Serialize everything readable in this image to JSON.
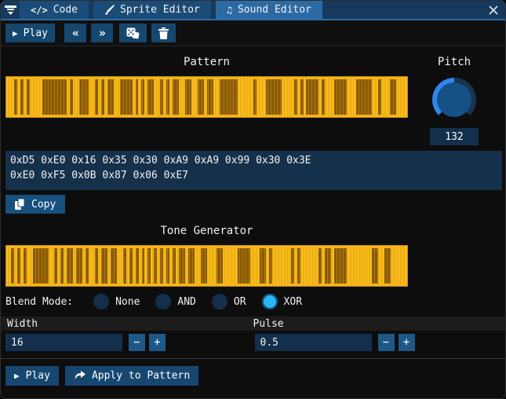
{
  "window": {
    "close_icon": "close"
  },
  "tabs": [
    {
      "label": "Code",
      "icon_text": "</>",
      "active": false
    },
    {
      "label": "Sprite Editor",
      "icon": "brush",
      "active": false
    },
    {
      "label": "Sound Editor",
      "icon_text": "♫",
      "active": true
    }
  ],
  "toolbar": {
    "play_label": "Play",
    "play_icon": "▶",
    "prev_icon": "«",
    "next_icon": "»",
    "random_icon": "dice",
    "delete_icon": "trash"
  },
  "pattern": {
    "title": "Pattern",
    "hex_text": "0xD5 0xE0 0x16 0x35 0x30 0xA9 0xA9 0x99 0x30 0x3E\n0xE0 0xF5 0x0B 0x87 0x06 0xE7",
    "copy_label": "Copy"
  },
  "pitch": {
    "title": "Pitch",
    "value": "132"
  },
  "tone": {
    "title": "Tone Generator",
    "segments": "y1 b1 y1 b1 y1 b1 y2 b5 y2 b1 y1 b1 y1 b2 y1 b2 y1 b1 y2 b1 y1 b2 y1 b2 y2 b1 y1 b1 y1 b1 y1 b1 y1 b1 y1 b1 y1 b1 y1 b1 y1 b1 y1 b2 y1 b2 y2 b2 y3 b2 y5 b4 y3 b2 y1 b1 y6 b1 y1 b1 y6 b1 y1 b2 y1 b4 y8 b2 y2 b2 y5"
  },
  "blend": {
    "label": "Blend Mode:",
    "options": [
      "None",
      "AND",
      "OR",
      "XOR"
    ],
    "selected": "XOR",
    "selected_index": 3
  },
  "width_field": {
    "label": "Width",
    "value": "16",
    "minus": "−",
    "plus": "+"
  },
  "pulse_field": {
    "label": "Pulse",
    "value": "0.5",
    "minus": "−",
    "plus": "+"
  },
  "footer": {
    "play_icon": "▶",
    "play_label": "Play",
    "apply_label": "Apply to Pattern"
  },
  "colors": {
    "titlebar": "#153a5e",
    "tab_active": "#2c6aa4",
    "tab_inactive": "#1b4c77",
    "accent_line": "#2d6ba3",
    "button_blue": "#16476f",
    "stepper_blue": "#1d5887",
    "input_bg": "#142f4c",
    "hex_bg": "#15304b",
    "stripe_yellow": "#f6b616",
    "stripe_brown": "#8d5b05",
    "knob_arc": "#2e86f0",
    "knob_track": "#1c3350",
    "knob_fill": "#155184",
    "radio_on": "#2ab6f7",
    "radio_off": "#152f4a",
    "background": "#0d0d0d"
  }
}
